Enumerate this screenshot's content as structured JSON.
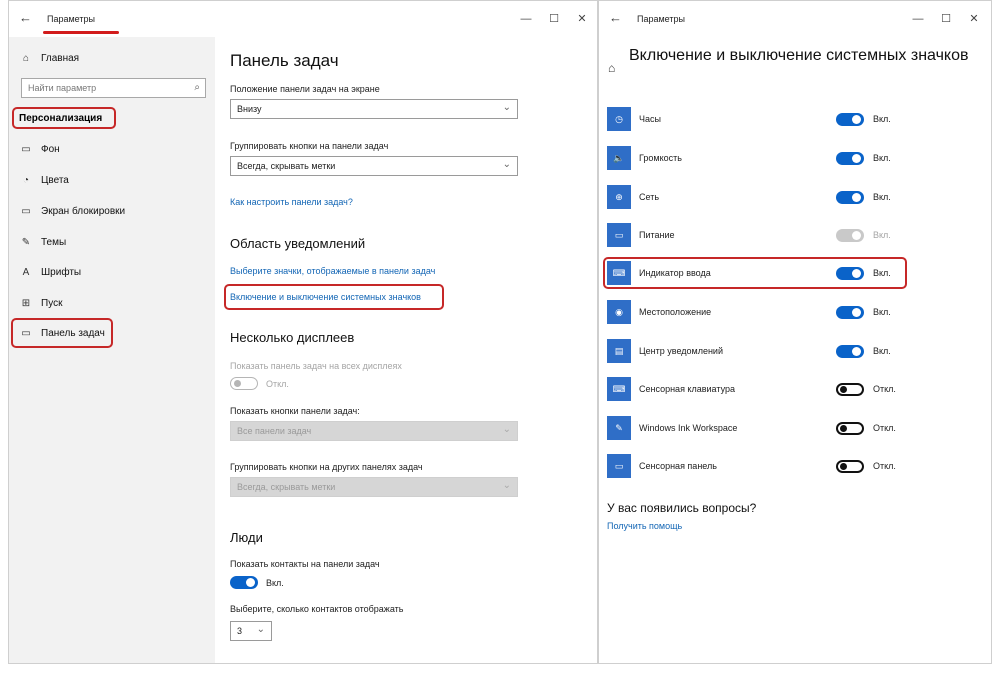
{
  "left_window": {
    "title": "Параметры",
    "back_icon": "←",
    "controls": {
      "minimize": "—",
      "maximize": "☐",
      "close": "✕"
    },
    "sidebar": {
      "home": {
        "icon": "⌂",
        "label": "Главная"
      },
      "search": {
        "placeholder": "Найти параметр",
        "icon": "⌕"
      },
      "section": "Персонализация",
      "items": [
        {
          "icon": "▭",
          "label": "Фон"
        },
        {
          "icon": "◔",
          "label": "Цвета"
        },
        {
          "icon": "▭",
          "label": "Экран блокировки"
        },
        {
          "icon": "✎",
          "label": "Темы"
        },
        {
          "icon": "A",
          "label": "Шрифты"
        },
        {
          "icon": "⊞",
          "label": "Пуск"
        },
        {
          "icon": "▭",
          "label": "Панель задач"
        }
      ]
    },
    "main": {
      "title": "Панель задач",
      "position_label": "Положение панели задач на экране",
      "position_value": "Внизу",
      "group_label": "Группировать кнопки на панели задач",
      "group_value": "Всегда, скрывать метки",
      "how_link": "Как настроить панели задач?",
      "notif_title": "Область уведомлений",
      "notif_link1": "Выберите значки, отображаемые в панели задач",
      "notif_link2": "Включение и выключение системных значков",
      "multi_title": "Несколько дисплеев",
      "multi_show_label": "Показать панель задач на всех дисплеях",
      "multi_show_state": "Откл.",
      "multi_buttons_label": "Показать кнопки панели задач:",
      "multi_buttons_value": "Все панели задач",
      "multi_group_label": "Группировать кнопки на других панелях задач",
      "multi_group_value": "Всегда, скрывать метки",
      "people_title": "Люди",
      "people_show_label": "Показать контакты на панели задач",
      "people_show_state": "Вкл.",
      "people_count_label": "Выберите, сколько контактов отображать",
      "people_count_value": "3"
    }
  },
  "right_window": {
    "title": "Параметры",
    "back_icon": "←",
    "home_icon": "⌂",
    "controls": {
      "minimize": "—",
      "maximize": "☐",
      "close": "✕"
    },
    "heading": "Включение и выключение системных значков",
    "rows": [
      {
        "icon": "◷",
        "label": "Часы",
        "state": "Вкл."
      },
      {
        "icon": "🔈",
        "label": "Громкость",
        "state": "Вкл."
      },
      {
        "icon": "⊕",
        "label": "Сеть",
        "state": "Вкл."
      },
      {
        "icon": "▭",
        "label": "Питание",
        "state": "Вкл."
      },
      {
        "icon": "⌨",
        "label": "Индикатор ввода",
        "state": "Вкл."
      },
      {
        "icon": "◉",
        "label": "Местоположение",
        "state": "Вкл."
      },
      {
        "icon": "▤",
        "label": "Центр уведомлений",
        "state": "Вкл."
      },
      {
        "icon": "⌨",
        "label": "Сенсорная клавиатура",
        "state": "Откл."
      },
      {
        "icon": "✎",
        "label": "Windows Ink Workspace",
        "state": "Откл."
      },
      {
        "icon": "▭",
        "label": "Сенсорная панель",
        "state": "Откл."
      }
    ],
    "help_heading": "У вас появились вопросы?",
    "help_link": "Получить помощь"
  },
  "colors": {
    "accent": "#0a63c9",
    "highlight": "#c62828",
    "link": "#1366b5"
  }
}
